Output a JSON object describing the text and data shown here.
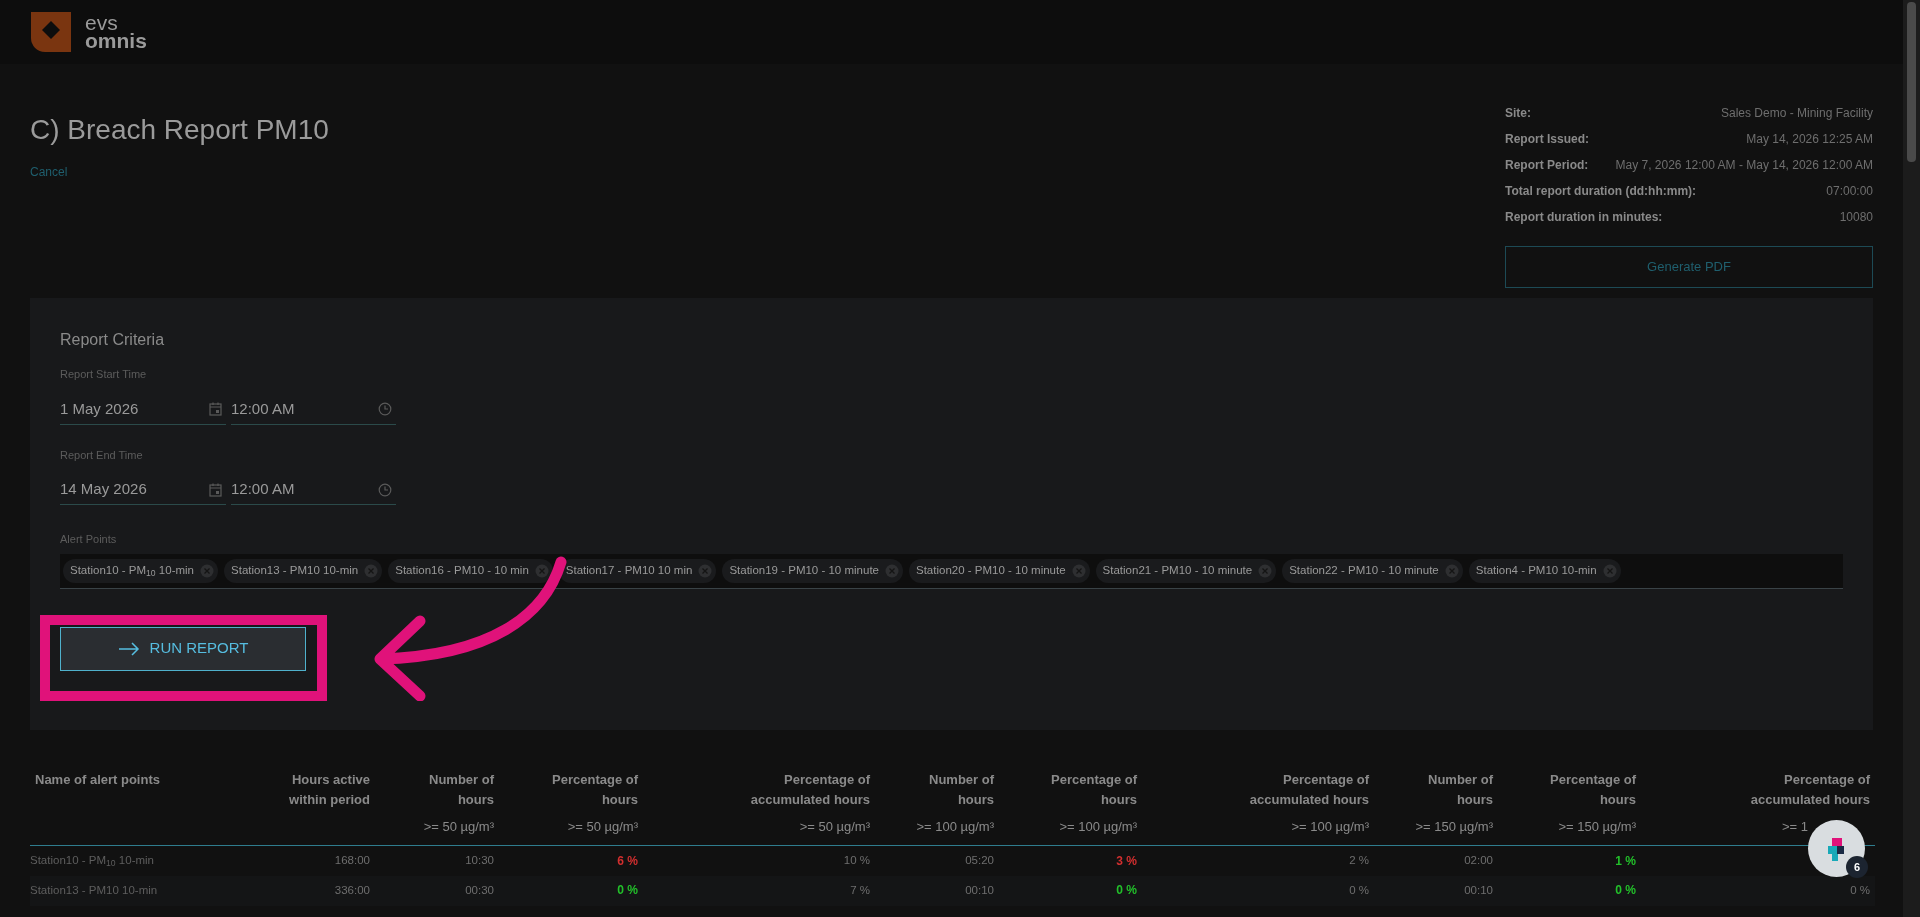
{
  "logo": {
    "line1": "evs",
    "line2": "omnis"
  },
  "title": "C) Breach Report PM10",
  "cancel": "Cancel",
  "info": [
    {
      "label": "Site:",
      "value": "Sales Demo - Mining Facility"
    },
    {
      "label": "Report Issued:",
      "value": "May 14, 2026 12:25 AM"
    },
    {
      "label": "Report Period:",
      "value": "May 7, 2026 12:00 AM - May 14, 2026 12:00 AM"
    },
    {
      "label": "Total report duration (dd:hh:mm):",
      "value": "07:00:00"
    },
    {
      "label": "Report duration in minutes:",
      "value": "10080"
    }
  ],
  "generate_button": "Generate PDF",
  "criteria": {
    "heading": "Report Criteria",
    "times": [
      {
        "label": "Report Start Time",
        "date": "1 May 2026",
        "time": "12:00 AM"
      },
      {
        "label": "Report End Time",
        "date": "14 May 2026",
        "time": "12:00 AM"
      }
    ],
    "alert_points_label": "Alert Points",
    "alert_points": [
      "Station10 - PM$_{10}$ 10-min",
      "Station13 - PM10 10-min",
      "Station16 - PM10 - 10 min",
      "Station17 - PM10 10 min",
      "Station19 - PM10 - 10 minute",
      "Station20 - PM10 - 10 minute",
      "Station21 - PM10 - 10 minute",
      "Station22 - PM10 - 10 minute",
      "Station4 - PM10 10-min"
    ],
    "run_button": "RUN REPORT"
  },
  "table": {
    "columns": [
      {
        "heading": "Name of alert points"
      },
      {
        "heading": "Hours active within period"
      },
      {
        "heading": "Number of hours",
        "unit": ">= 50 µg/m³"
      },
      {
        "heading": "Percentage of hours",
        "unit": ">= 50 µg/m³"
      },
      {
        "heading": "Percentage of accumulated hours",
        "unit": ">= 50 µg/m³"
      },
      {
        "heading": "Number of hours",
        "unit": ">= 100 µg/m³"
      },
      {
        "heading": "Percentage of hours",
        "unit": ">= 100 µg/m³"
      },
      {
        "heading": "Percentage of accumulated hours",
        "unit": ">= 100 µg/m³"
      },
      {
        "heading": "Number of hours",
        "unit": ">= 150 µg/m³"
      },
      {
        "heading": "Percentage of hours",
        "unit": ">= 150 µg/m³"
      },
      {
        "heading": "Percentage of accumulated hours",
        "unit": ">= 1"
      }
    ],
    "rows": [
      {
        "cells": [
          {
            "text": "Station10 - PM$_{10}$ 10-min"
          },
          {
            "text": "168:00"
          },
          {
            "text": "10:30"
          },
          {
            "text": "6 %",
            "color": "#d32f2f"
          },
          {
            "text": "10 %"
          },
          {
            "text": "05:20"
          },
          {
            "text": "3 %",
            "color": "#d32f2f"
          },
          {
            "text": "2 %"
          },
          {
            "text": "02:00"
          },
          {
            "text": "1 %",
            "color": "#22c02a"
          }
        ]
      },
      {
        "cells": [
          {
            "text": "Station13 - PM10 10-min"
          },
          {
            "text": "336:00"
          },
          {
            "text": "00:30"
          },
          {
            "text": "0 %",
            "color": "#22c02a"
          },
          {
            "text": "7 %"
          },
          {
            "text": "00:10"
          },
          {
            "text": "0 %",
            "color": "#22c02a"
          },
          {
            "text": "0 %"
          },
          {
            "text": "00:10"
          },
          {
            "text": "0 %",
            "color": "#22c02a"
          },
          {
            "text": "0 %"
          }
        ]
      }
    ]
  },
  "help_badge": {
    "count": "6"
  }
}
